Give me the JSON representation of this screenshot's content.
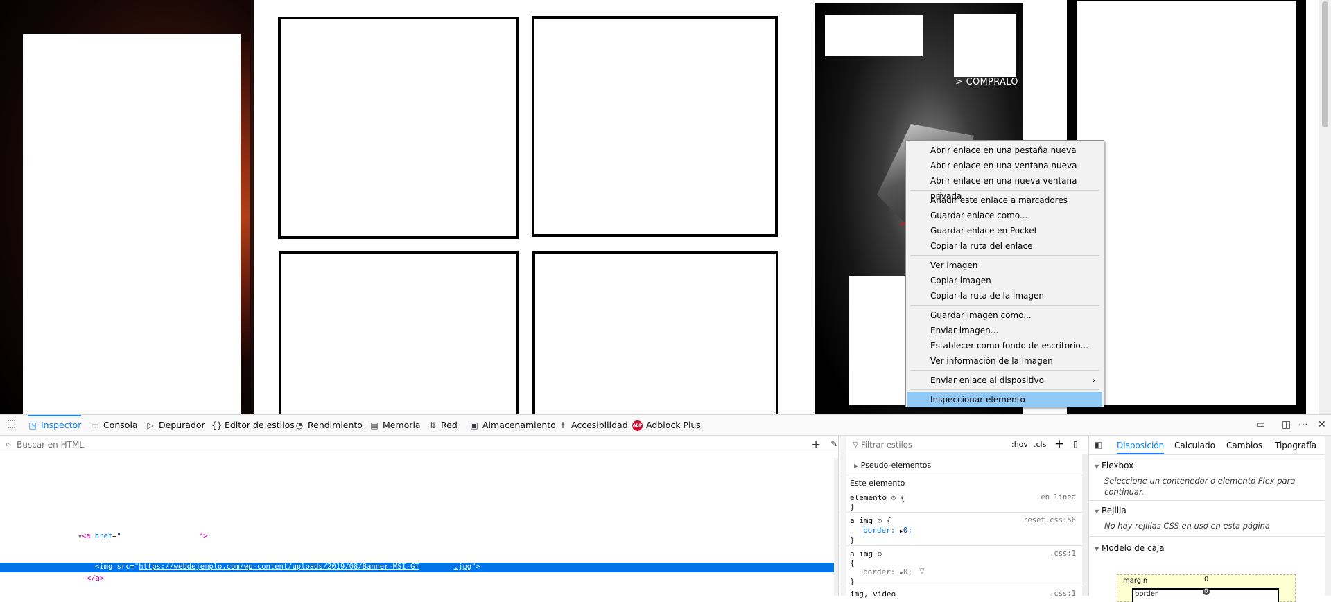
{
  "page": {
    "banner_cta": "> CÓMPRALO"
  },
  "context_menu": {
    "items": [
      {
        "label": "Abrir enlace en una pestaña nueva"
      },
      {
        "label": "Abrir enlace en una ventana nueva"
      },
      {
        "label": "Abrir enlace en una nueva ventana privada"
      },
      {
        "label": "Añadir este enlace a marcadores"
      },
      {
        "label": "Guardar enlace como..."
      },
      {
        "label": "Guardar enlace en Pocket"
      },
      {
        "label": "Copiar la ruta del enlace"
      },
      {
        "label": "Ver imagen"
      },
      {
        "label": "Copiar imagen"
      },
      {
        "label": "Copiar la ruta de la imagen"
      },
      {
        "label": "Guardar imagen como..."
      },
      {
        "label": "Enviar imagen..."
      },
      {
        "label": "Establecer como fondo de escritorio..."
      },
      {
        "label": "Ver información de la imagen"
      },
      {
        "label": "Enviar enlace al dispositivo"
      },
      {
        "label": "Inspeccionar elemento"
      }
    ]
  },
  "devtools": {
    "tabs": [
      {
        "label": "Inspector",
        "icon": "inspector-icon"
      },
      {
        "label": "Consola",
        "icon": "console-icon"
      },
      {
        "label": "Depurador",
        "icon": "debugger-icon"
      },
      {
        "label": "Editor de estilos",
        "icon": "braces-icon"
      },
      {
        "label": "Rendimiento",
        "icon": "performance-icon"
      },
      {
        "label": "Memoria",
        "icon": "memory-icon"
      },
      {
        "label": "Red",
        "icon": "network-icon"
      },
      {
        "label": "Almacenamiento",
        "icon": "storage-icon"
      },
      {
        "label": "Accesibilidad",
        "icon": "accessibility-icon"
      },
      {
        "label": "Adblock Plus",
        "icon": "abp-icon"
      }
    ],
    "abp_badge": "ABP",
    "markup": {
      "search_placeholder": "Buscar en HTML",
      "line1_tag_open": "<a ",
      "line1_attr": "href",
      "line1_eq": "=",
      "line1_val": "\"",
      "line1_close": "\">",
      "line2_tag_open": "<img ",
      "line2_attr": "src",
      "line2_eq": "=\"",
      "line2_url_a": "https://webdejemplo.com/wp-content/uploads/2019/08/Banner-MSI-GT",
      "line2_url_b": ".jpg",
      "line2_close": "\">",
      "line3": "</a>"
    },
    "rules": {
      "filter_placeholder": "Filtrar estilos",
      "hov": ":hov",
      "cls": ".cls",
      "pseudo": "Pseudo-elementos",
      "this_element": "Este elemento",
      "r1_selector": "elemento",
      "r1_brace": "{",
      "r1_src": "en línea",
      "r1_close": "}",
      "r2_selector": "a img",
      "r2_src": "reset.css:56",
      "r2_prop": "border:",
      "r2_val": "0;",
      "r3_selector": "a img",
      "r3_src": ".css:1",
      "r3_brace": "{",
      "r3_prop": "border:",
      "r3_val": "0;",
      "r4_selector": "img, video",
      "r4_src": ".css:1"
    },
    "layout": {
      "tabs": [
        "Disposición",
        "Calculado",
        "Cambios",
        "Tipografía"
      ],
      "flexbox_title": "Flexbox",
      "flexbox_msg": "Seleccione un contenedor o elemento Flex para continuar.",
      "grid_title": "Rejilla",
      "grid_msg": "No hay rejillas CSS en uso en esta página",
      "boxmodel_title": "Modelo de caja",
      "margin_label": "margin",
      "margin_value": "0",
      "border_label": "border",
      "border_value": "0"
    }
  },
  "colors": {
    "accent": "#0a84ff",
    "selection": "#0074e8",
    "menu_highlight": "#91c9f7",
    "abp_red": "#c70d2c"
  }
}
